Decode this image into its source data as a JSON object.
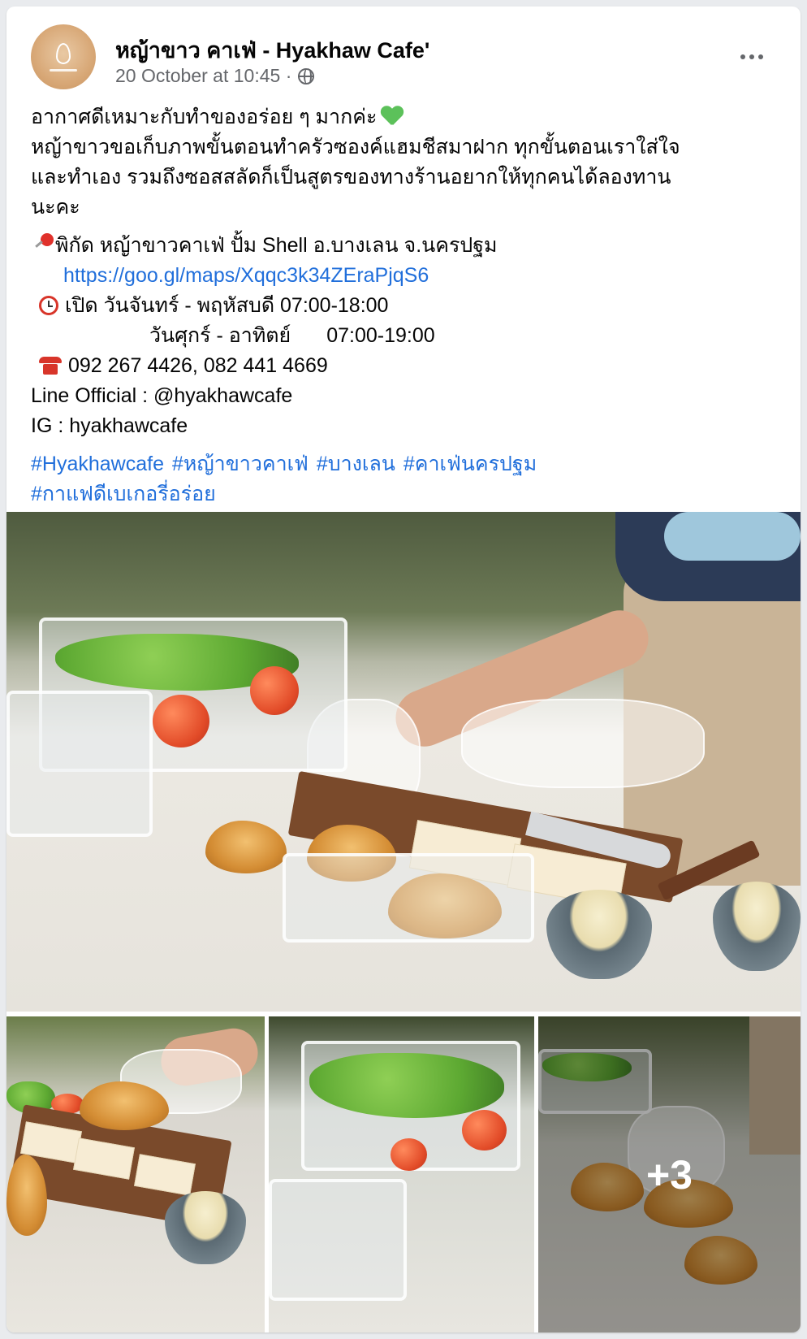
{
  "post": {
    "page_name": "หญ้าขาว คาเฟ่ - Hyakhaw Cafe'",
    "timestamp": "20 October at 10:45 ·",
    "privacy_icon": "globe-icon",
    "more_icon": "more-dots-icon"
  },
  "body": {
    "line1": "อากาศดีเหมาะกับทำของอร่อย ๆ มากค่ะ",
    "line2": "หญ้าขาวขอเก็บภาพขั้นตอนทำครัวซองค์แฮมชีสมาฝาก ทุกขั้นตอนเราใส่ใจ",
    "line3": "และทำเอง รวมถึงซอสสลัดก็เป็นสูตรของทางร้านอยากให้ทุกคนได้ลองทาน",
    "line4": "นะคะ",
    "location": "พิกัด หญ้าขาวคาเฟ่ ปั้ม Shell อ.บางเลน จ.นครปฐม",
    "map_link": "https://goo.gl/maps/Xqqc3k34ZEraPjqS6",
    "hours_label": "เปิด",
    "hours_days_1": "วันจันทร์ - พฤหัสบดี",
    "hours_time_1": "07:00-18:00",
    "hours_days_2": "วันศุกร์ - อาทิตย์",
    "hours_time_2": "07:00-19:00",
    "phones": "092 267 4426, 082 441 4669",
    "line_official": "Line Official : @hyakhawcafe",
    "ig": "IG : hyakhawcafe",
    "hashtags": [
      "#Hyakhawcafe",
      "#หญ้าขาวคาเฟ่",
      "#บางเลน",
      "#คาเฟ่นครปฐม",
      "#กาแฟดีเบเกอรี่อร่อย"
    ]
  },
  "photos": {
    "more_count": "+3"
  },
  "colors": {
    "link": "#216fdb",
    "meta_text": "#65676b",
    "heart": "#5cc15a"
  }
}
